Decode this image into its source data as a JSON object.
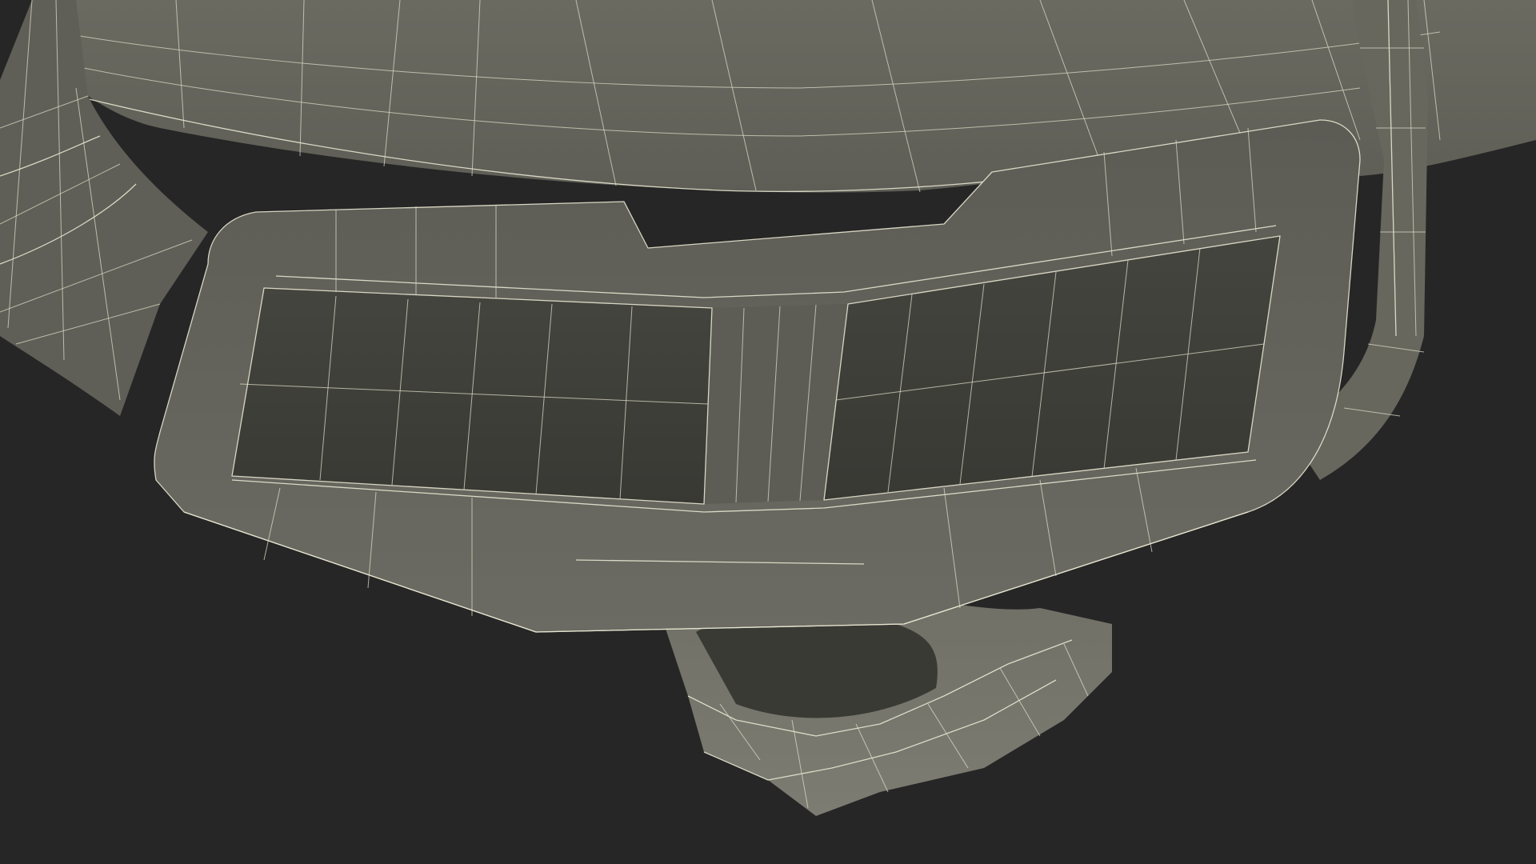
{
  "scene": {
    "subject": "wireframe-3d-model",
    "background_color": "#262626",
    "surface_color": "#62625a",
    "wire_color": "#e7e6d0"
  }
}
